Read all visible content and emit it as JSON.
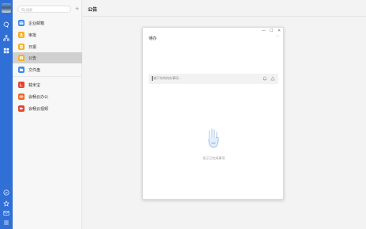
{
  "colors": {
    "rail": "#2f6fd6",
    "accent_blue": "#3c8be8",
    "accent_yellow": "#f5b023",
    "accent_red": "#e0442e",
    "accent_orange": "#f26522"
  },
  "rail": {
    "icons": [
      "chat-icon",
      "org-chart-icon",
      "apps-icon",
      "check-circle-icon",
      "star-icon",
      "mail-icon",
      "menu-icon"
    ]
  },
  "search": {
    "placeholder": "搜索",
    "add": "+"
  },
  "sidebar": {
    "items": [
      {
        "label": "企业邮箱",
        "icon": "mail-icon",
        "color": "#3c8be8"
      },
      {
        "label": "审批",
        "icon": "approval-icon",
        "color": "#f5b023"
      },
      {
        "label": "日报",
        "icon": "report-icon",
        "color": "#f5b023"
      },
      {
        "label": "公告",
        "icon": "announcement-icon",
        "color": "#f5b023",
        "active": true
      },
      {
        "label": "文件盘",
        "icon": "folder-icon",
        "color": "#3c8be8"
      },
      {
        "label": "载米宝",
        "icon": "app-icon",
        "color": "#e0442e"
      },
      {
        "label": "会畅云办公",
        "icon": "cloud-office-icon",
        "color": "#f26522"
      },
      {
        "label": "会畅云视频",
        "icon": "video-icon",
        "color": "#e0442e"
      }
    ]
  },
  "main": {
    "title": "公告"
  },
  "dialog": {
    "title": "待办",
    "more": "···",
    "window_buttons": [
      "—",
      "☐",
      "✕"
    ],
    "input_placeholder": "输下你的待办事项...",
    "empty_text": "显示已完成事项"
  }
}
